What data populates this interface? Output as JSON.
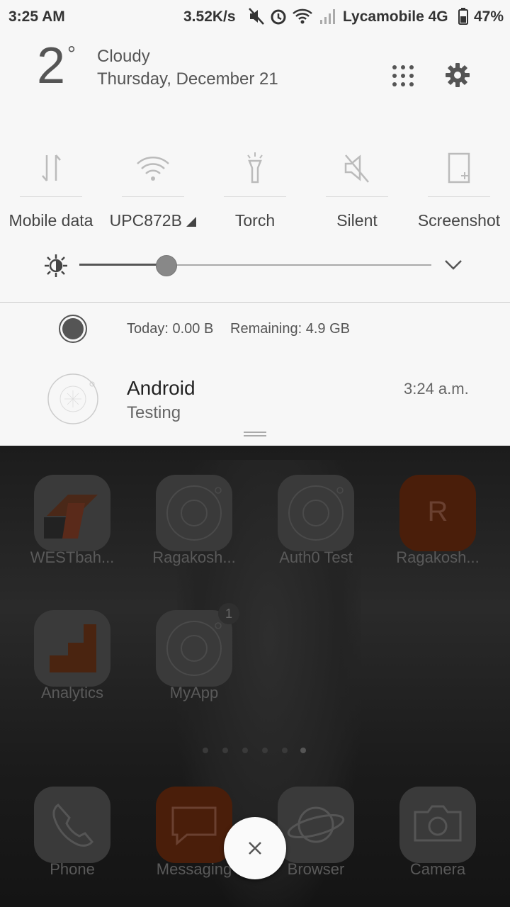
{
  "status_bar": {
    "time": "3:25 AM",
    "speed": "3.52K/s",
    "carrier": "Lycamobile 4G",
    "battery": "47%"
  },
  "weather": {
    "temperature": "2",
    "degree_symbol": "°",
    "condition": "Cloudy",
    "date": "Thursday, December 21"
  },
  "quick_settings": [
    {
      "label": "Mobile data",
      "icon": "mobile-data-icon"
    },
    {
      "label": "UPC872B",
      "icon": "wifi-icon"
    },
    {
      "label": "Torch",
      "icon": "torch-icon"
    },
    {
      "label": "Silent",
      "icon": "silent-icon"
    },
    {
      "label": "Screenshot",
      "icon": "screenshot-icon"
    }
  ],
  "brightness": {
    "level": 0.25
  },
  "data_usage": {
    "today": "Today: 0.00 B",
    "remaining": "Remaining: 4.9 GB"
  },
  "notification": {
    "title": "Android",
    "text": "Testing",
    "time": "3:24 a.m."
  },
  "home_apps": [
    {
      "name": "WESTbah...",
      "color": "#5a2a1a"
    },
    {
      "name": "Ragakosh...",
      "color": "#3c3c3c"
    },
    {
      "name": "Auth0 Test",
      "color": "#3c3c3c"
    },
    {
      "name": "Ragakosh...",
      "color": "#5a2008",
      "letter": "R"
    },
    {
      "name": "Analytics",
      "color": "#4a2a1a"
    },
    {
      "name": "MyApp",
      "color": "#3c3c3c",
      "badge": "1"
    }
  ],
  "dock": [
    {
      "name": "Phone"
    },
    {
      "name": "Messaging"
    },
    {
      "name": "Browser"
    },
    {
      "name": "Camera"
    }
  ],
  "colors": {
    "shade_background": "#f7f7f7",
    "text_primary": "#222222",
    "text_secondary": "#555555",
    "accent_dim_orange": "#5a2008"
  }
}
